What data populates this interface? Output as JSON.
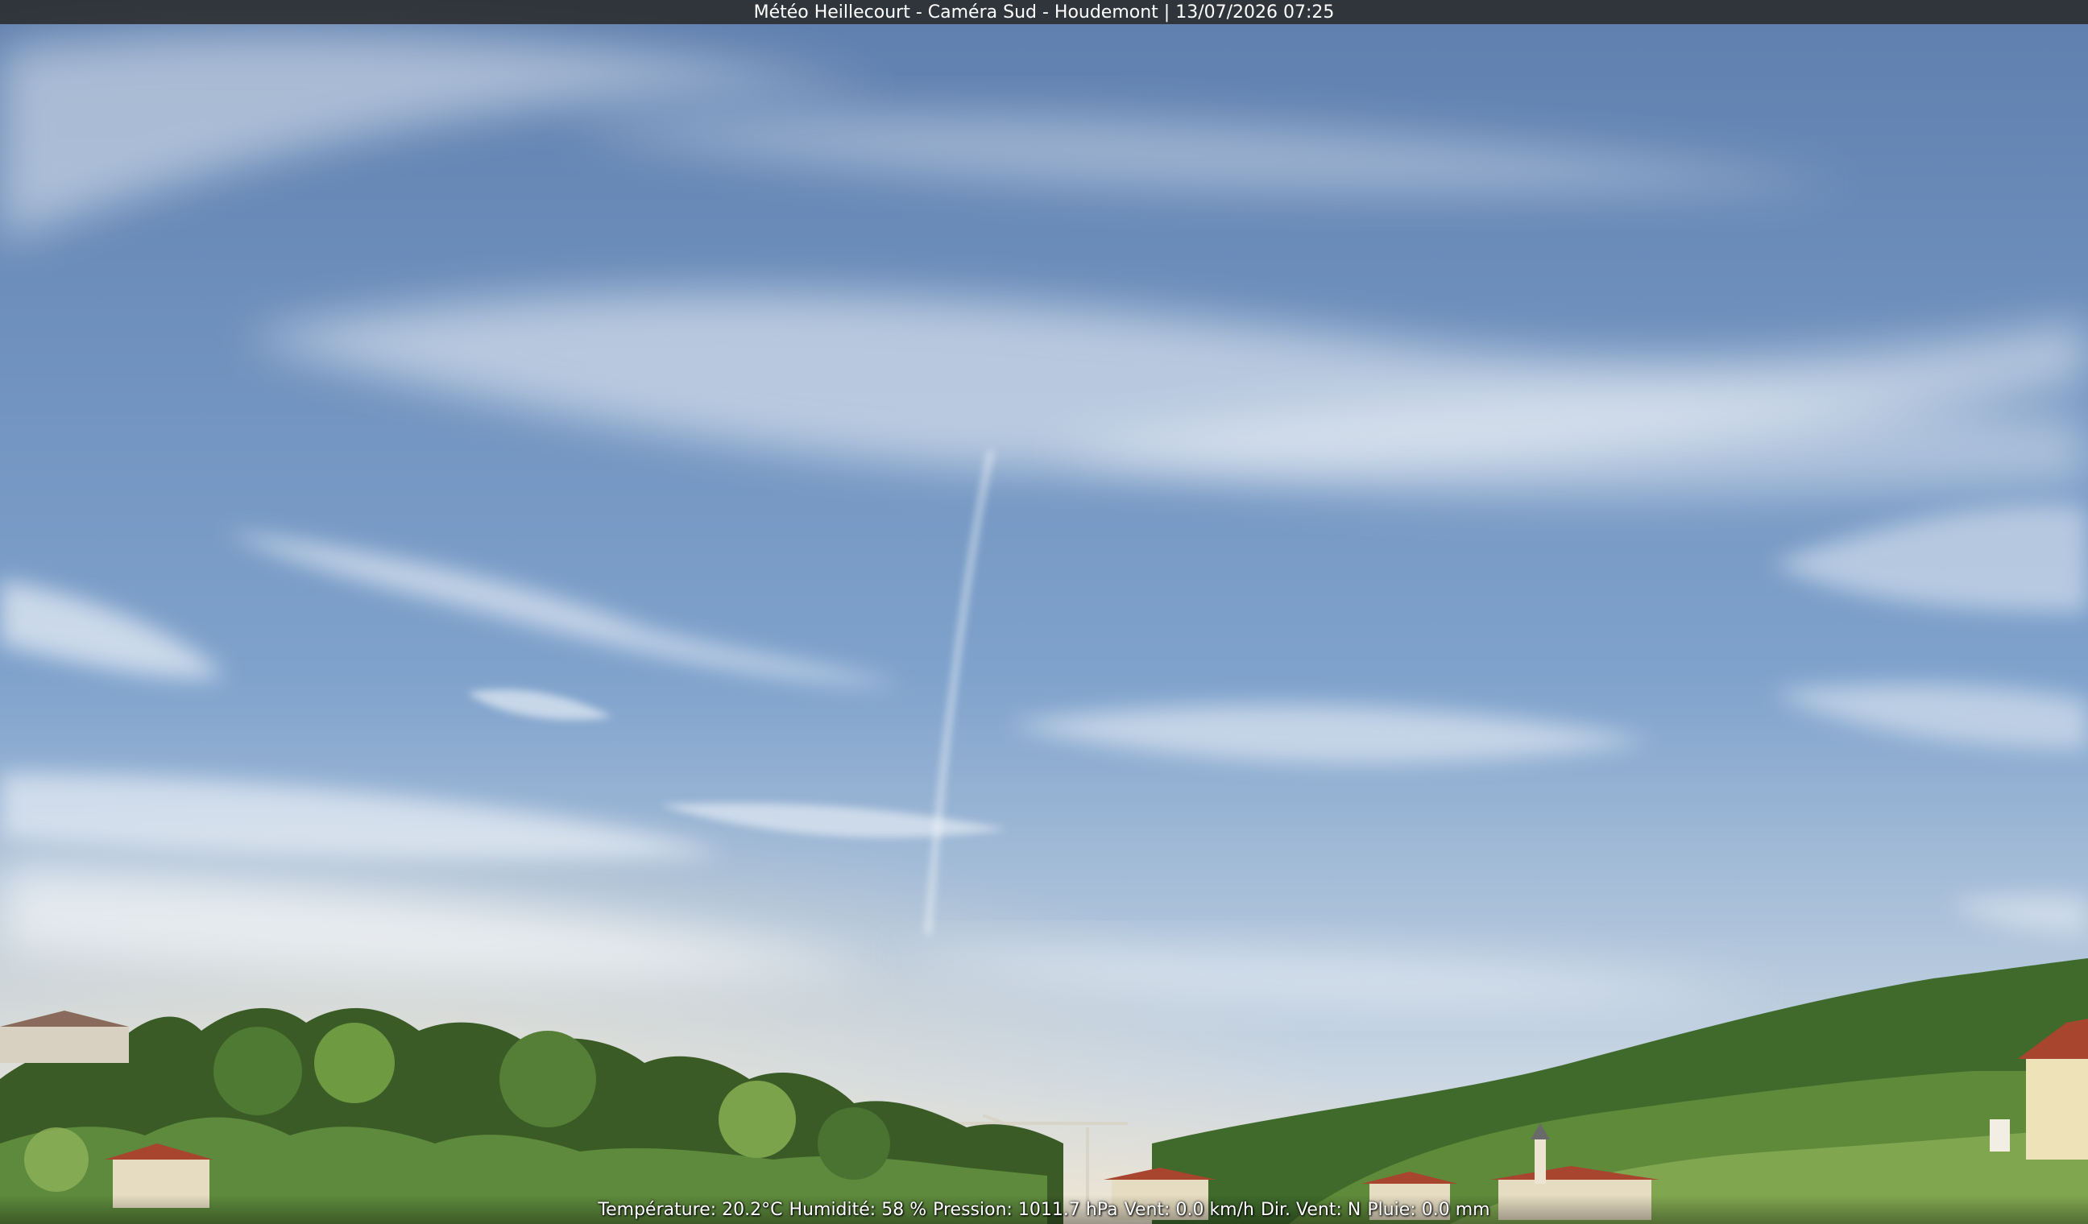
{
  "overlay": {
    "title": "Météo Heillecourt - Caméra Sud - Houdemont | 13/07/2026 07:25",
    "readings": [
      "Température: 20.2°C",
      "Humidité: 58 %",
      "Pression: 1011.7 hPa",
      "Vent: 0.0 km/h",
      "Dir. Vent: N",
      "Pluie: 0.0 mm"
    ]
  },
  "scene": {
    "sky_top": "#5f7fae",
    "sky_mid": "#7fa2cc",
    "sky_bottom": "#c9d6e3",
    "horizon_glow": "#f0e6d2",
    "trees_dark": "#2f4a22",
    "trees_mid": "#4f7a34",
    "trees_light": "#8fb35a",
    "roof": "#a8452e",
    "wall": "#e6dcc2"
  }
}
